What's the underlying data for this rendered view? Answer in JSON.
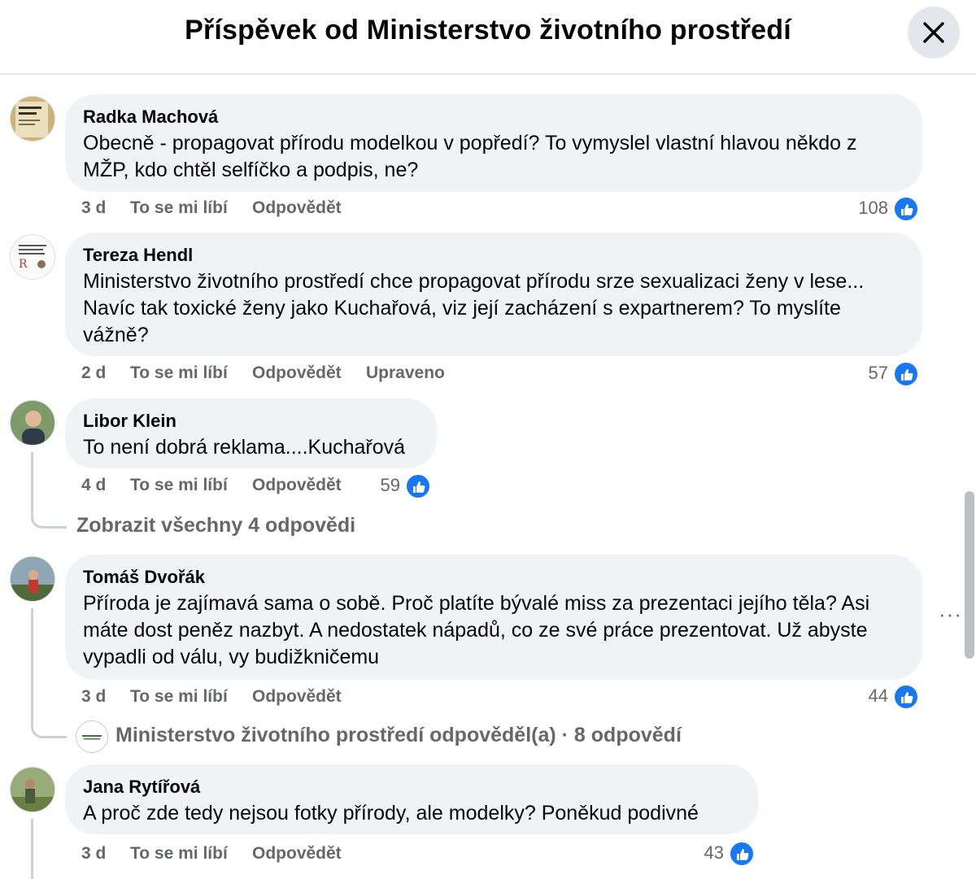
{
  "header": {
    "title": "Příspěvek od Ministerstvo životního prostředí"
  },
  "comments": [
    {
      "author": "Radka Machová",
      "text": "Obecně - propagovat přírodu modelkou v popředí? To vymyslel vlastní hlavou někdo z MŽP, kdo chtěl selfíčko a podpis, ne?",
      "age": "3 d",
      "like_label": "To se mi líbí",
      "reply_label": "Odpovědět",
      "reactions": "108"
    },
    {
      "author": "Tereza Hendl",
      "text": "Ministerstvo životního prostředí chce propagovat přírodu srze sexualizaci ženy v lese... Navíc tak toxické ženy jako Kuchařová, viz její zacházení s expartnerem? To myslíte vážně?",
      "age": "2 d",
      "like_label": "To se mi líbí",
      "reply_label": "Odpovědět",
      "edited_label": "Upraveno",
      "reactions": "57"
    },
    {
      "author": "Libor Klein",
      "text": "To není dobrá reklama....Kuchařová",
      "age": "4 d",
      "like_label": "To se mi líbí",
      "reply_label": "Odpovědět",
      "reactions": "59",
      "view_replies": "Zobrazit všechny 4 odpovědi"
    },
    {
      "author": "Tomáš Dvořák",
      "text": "Příroda je zajímavá sama o sobě. Proč platíte bývalé miss za prezentaci jejího těla? Asi máte dost peněz nazbyt. A nedostatek nápadů, co ze své práce prezentovat. Už abyste vypadli od válu, vy budižkničemu",
      "age": "3 d",
      "like_label": "To se mi líbí",
      "reply_label": "Odpovědět",
      "reactions": "44",
      "reply_preview": "Ministerstvo životního prostředí odpověděl(a) · 8 odpovědí",
      "more": "···"
    },
    {
      "author": "Jana Rytířová",
      "text": "A proč zde tedy nejsou fotky přírody, ale modelky? Poněkud podivné",
      "age": "3 d",
      "like_label": "To se mi líbí",
      "reply_label": "Odpovědět",
      "reactions": "43"
    }
  ],
  "colors": {
    "like_blue": "#1877f2",
    "bubble_bg": "#f0f2f5",
    "meta_gray": "#65676b"
  },
  "icons": [
    "close-icon",
    "like-icon",
    "more-icon"
  ]
}
